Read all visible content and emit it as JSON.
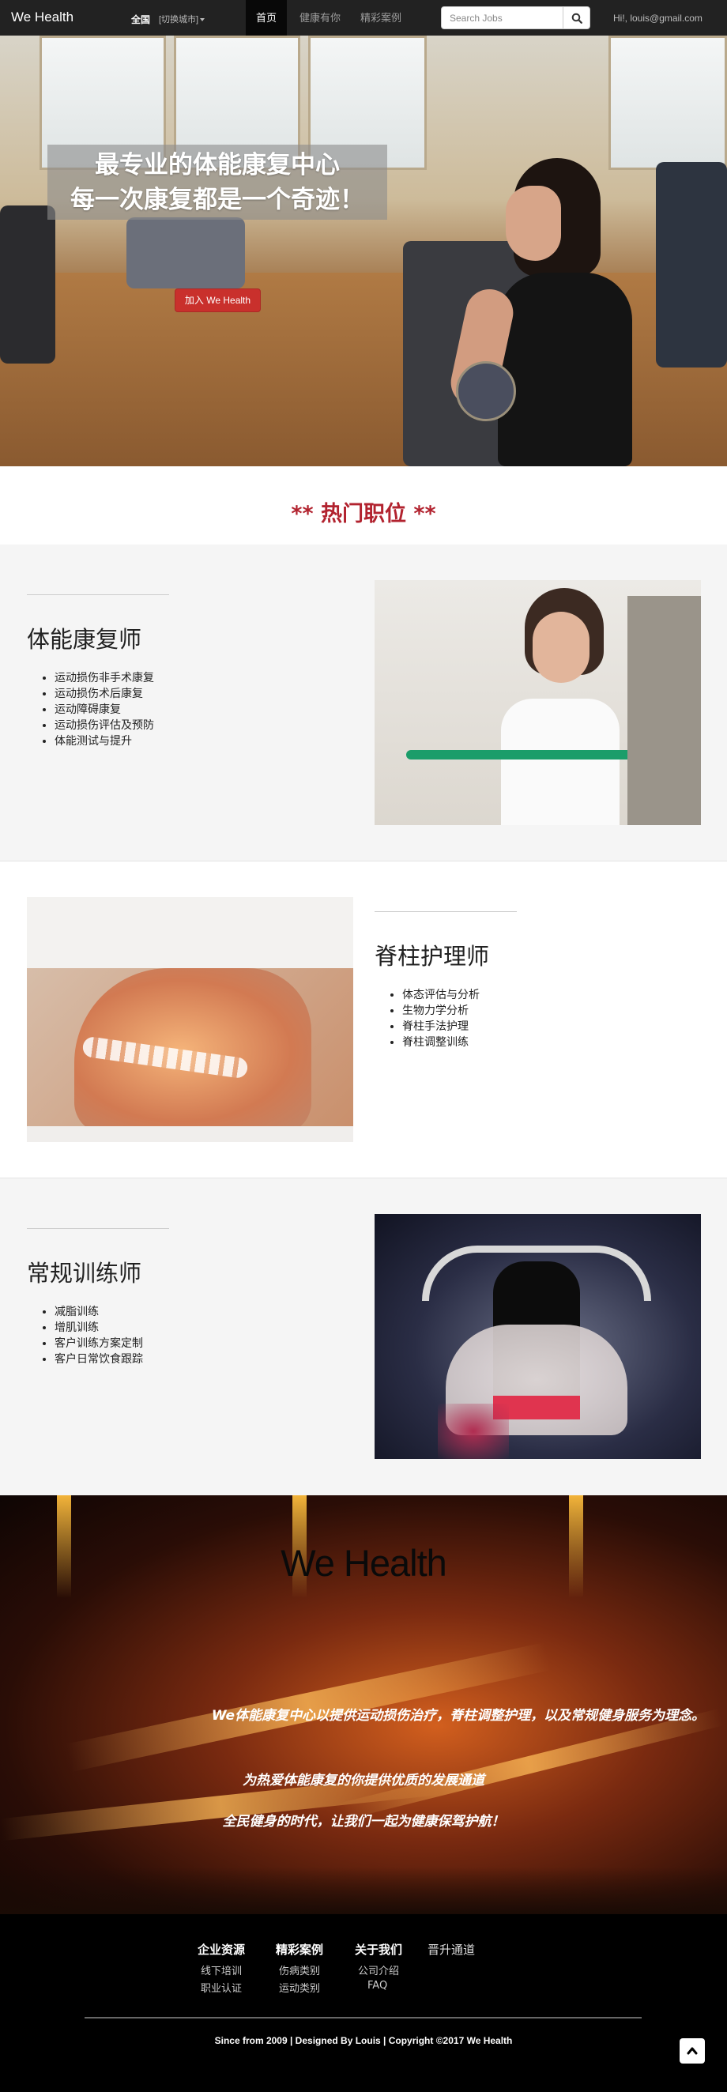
{
  "navbar": {
    "brand": "We Health",
    "city": "全国",
    "switch_city": "[切换城市]",
    "nav": [
      {
        "label": "首页",
        "active": true
      },
      {
        "label": "健康有你",
        "active": false
      },
      {
        "label": "精彩案例",
        "active": false
      }
    ],
    "search_placeholder": "Search Jobs",
    "search_icon": "search-icon",
    "user": "Hi!, louis@gmail.com"
  },
  "hero": {
    "title_line1": "最专业的体能康复中心",
    "title_line2": "每一次康复都是一个奇迹！",
    "join_button": "加入 We Health"
  },
  "hot_jobs": {
    "heading": "** 热门职位 **"
  },
  "jobs": [
    {
      "title": "体能康复师",
      "items": [
        "运动损伤非手术康复",
        "运动损伤术后康复",
        "运动障碍康复",
        "运动损伤评估及预防",
        "体能测试与提升"
      ]
    },
    {
      "title": "脊柱护理师",
      "items": [
        "体态评估与分析",
        "生物力学分析",
        "脊柱手法护理",
        "脊柱调整训练"
      ]
    },
    {
      "title": "常规训练师",
      "items": [
        "减脂训练",
        "增肌训练",
        "客户训练方案定制",
        "客户日常饮食跟踪"
      ]
    }
  ],
  "promo": {
    "title": "We Health",
    "line1": "We体能康复中心以提供运动损伤治疗，脊柱调整护理，以及常规健身服务为理念。",
    "line2": "为热爱体能康复的你提供优质的发展通道",
    "line3": "全民健身的时代，让我们一起为健康保驾护航！"
  },
  "footer": {
    "columns": [
      {
        "heading": "企业资源",
        "links": [
          "线下培训",
          "职业认证"
        ]
      },
      {
        "heading": "精彩案例",
        "links": [
          "伤病类别",
          "运动类别"
        ]
      },
      {
        "heading": "关于我们",
        "links": [
          "公司介绍",
          "FAQ"
        ]
      },
      {
        "heading": "晋升通道",
        "links": []
      }
    ],
    "copyright": "Since from 2009 | Designed By Louis | Copyright ©2017 We Health",
    "back_to_top_icon": "chevron-up-icon"
  },
  "colors": {
    "navbar": "#222222",
    "accent_red": "#c9302c",
    "hot_heading": "#b2232f",
    "section_grey": "#f5f5f5",
    "footer": "#000000"
  }
}
